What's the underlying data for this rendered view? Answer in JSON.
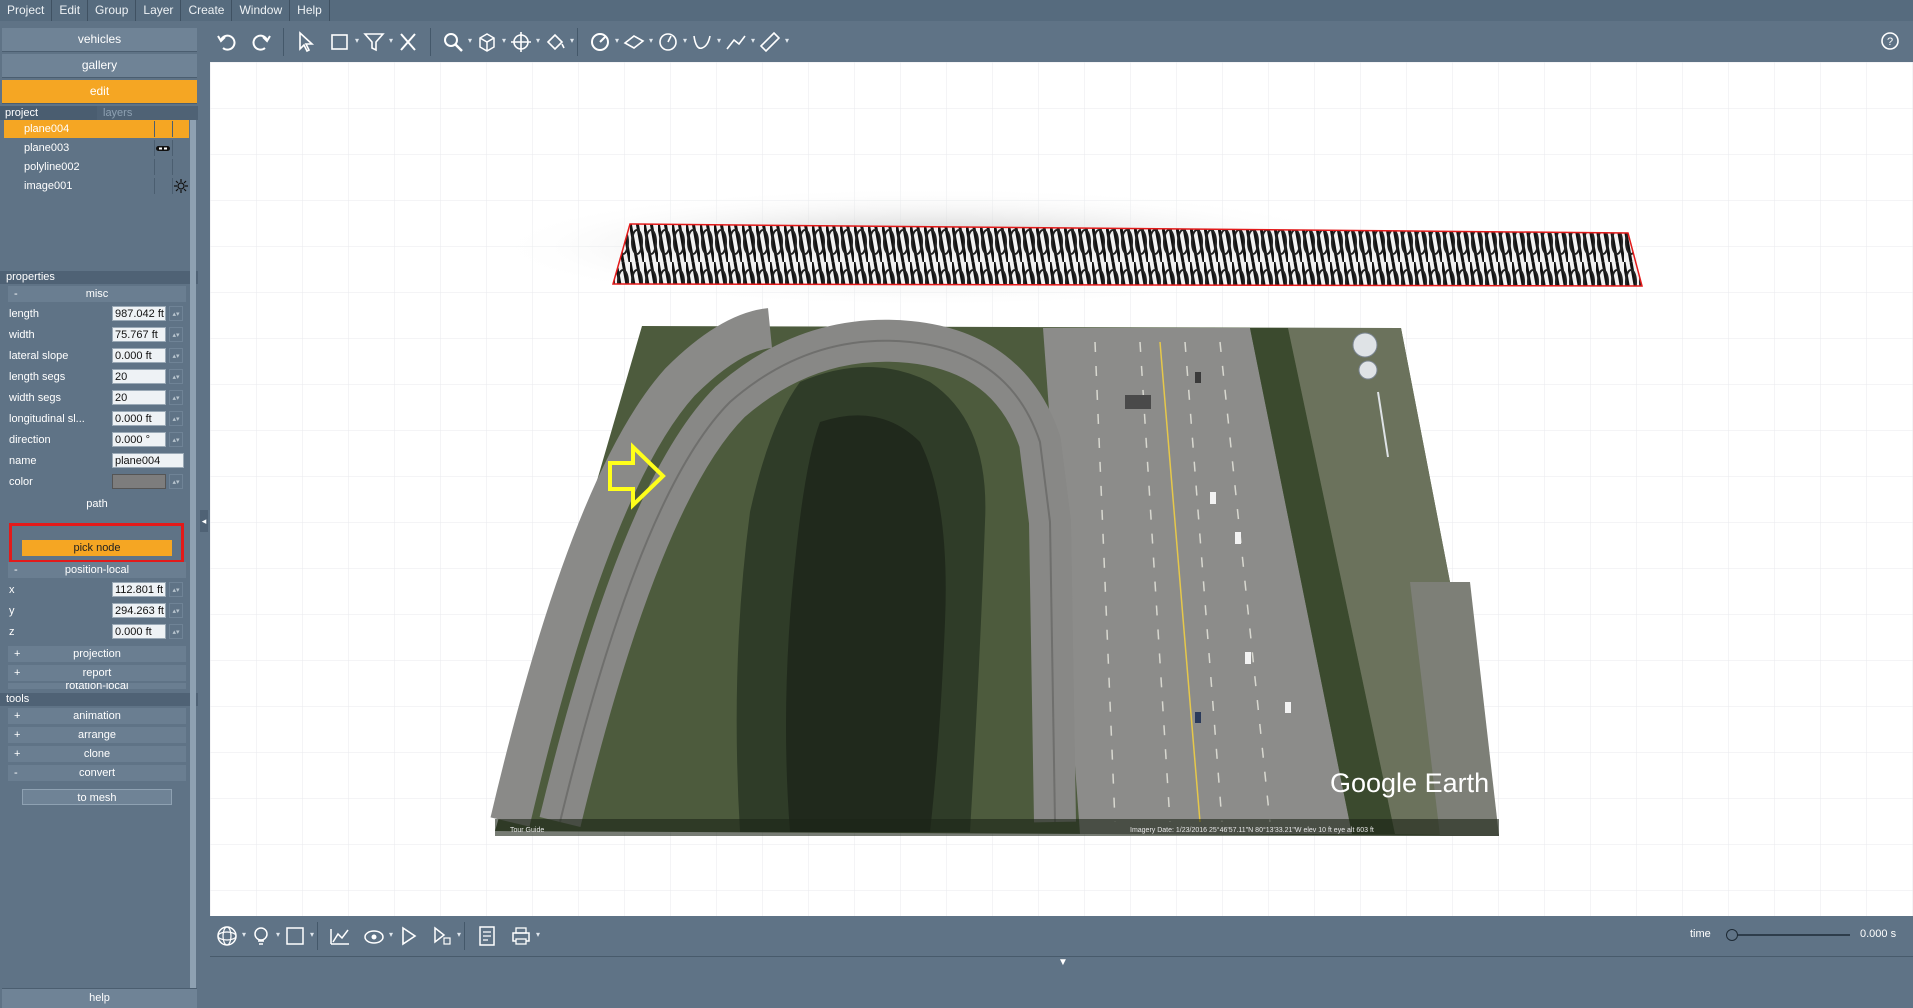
{
  "menu": [
    "Project",
    "Edit",
    "Group",
    "Layer",
    "Create",
    "Window",
    "Help"
  ],
  "nav": {
    "vehicles": "vehicles",
    "gallery": "gallery",
    "edit": "edit"
  },
  "tabs": {
    "project": "project",
    "layers": "layers"
  },
  "layers": [
    {
      "name": "plane004",
      "selected": true
    },
    {
      "name": "plane003",
      "selected": false,
      "icon": "link-icon"
    },
    {
      "name": "polyline002",
      "selected": false
    },
    {
      "name": "image001",
      "selected": false,
      "icon": "sun-icon"
    }
  ],
  "properties": {
    "header": "properties",
    "misc": "misc",
    "rows": [
      {
        "label": "length",
        "value": "987.042 ft"
      },
      {
        "label": "width",
        "value": "75.767 ft"
      },
      {
        "label": "lateral slope",
        "value": "0.000 ft"
      },
      {
        "label": "length segs",
        "value": "20"
      },
      {
        "label": "width segs",
        "value": "20"
      },
      {
        "label": "longitudinal sl...",
        "value": "0.000 ft"
      },
      {
        "label": "direction",
        "value": "0.000 °"
      },
      {
        "label": "name",
        "value": "plane004"
      },
      {
        "label": "color",
        "value": ""
      }
    ],
    "path": "path",
    "pick_node": "pick node",
    "position_local": "position-local",
    "pos_rows": [
      {
        "label": "x",
        "value": "112.801 ft"
      },
      {
        "label": "y",
        "value": "294.263 ft"
      },
      {
        "label": "z",
        "value": "0.000 ft"
      }
    ],
    "projection": "projection",
    "report": "report",
    "rotation_local": "rotation-local"
  },
  "tools": {
    "header": "tools",
    "animation": "animation",
    "arrange": "arrange",
    "clone": "clone",
    "convert": "convert",
    "to_mesh": "to mesh"
  },
  "help": "help",
  "time": {
    "label": "time",
    "value": "0.000 s"
  },
  "map_overlay": {
    "brand": "Google Earth",
    "tour_guide": "Tour Guide",
    "footer": "Imagery Date: 1/23/2016   25°46'57.11\"N  80°13'33.21\"W  elev   10 ft    eye alt  603 ft"
  },
  "colors": {
    "accent": "#f5a623",
    "panel": "#5f7386",
    "highlight_box": "#e31a1a",
    "arrow": "#ffff1a"
  }
}
